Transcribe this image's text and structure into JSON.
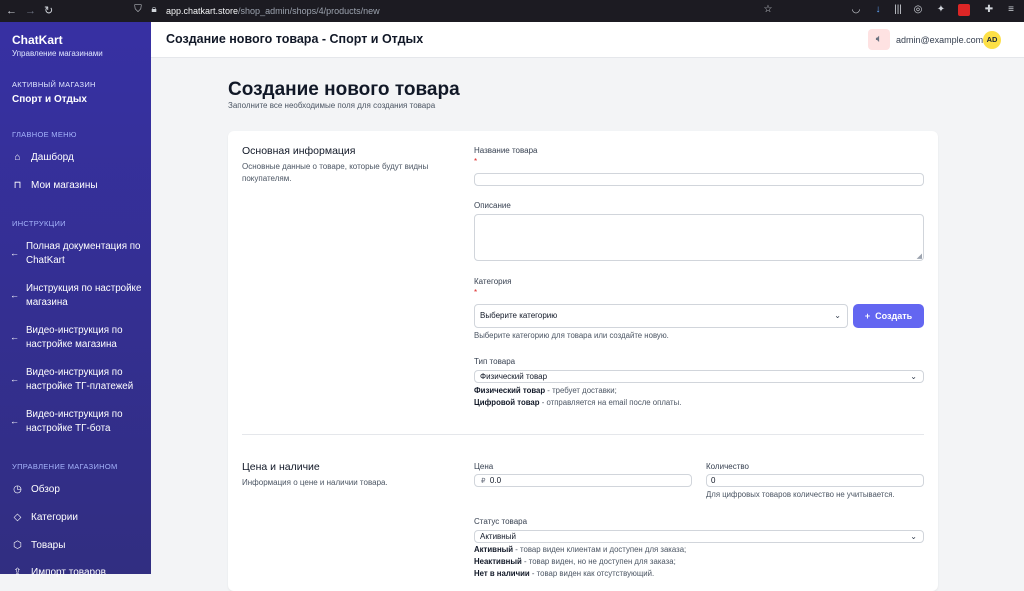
{
  "browser": {
    "url_host": "app.chatkart.store",
    "url_path": "/shop_admin/shops/4/products/new"
  },
  "sidebar": {
    "brand": "ChatKart",
    "brand_sub": "Управление магазинами",
    "active_label": "АКТИВНЫЙ МАГАЗИН",
    "active_name": "Спорт и Отдых",
    "main_menu_label": "ГЛАВНОЕ МЕНЮ",
    "main_menu": [
      "Дашборд",
      "Мои магазины"
    ],
    "instructions_label": "ИНСТРУКЦИИ",
    "instructions": [
      [
        "Полная документация по",
        "ChatKart"
      ],
      [
        "Инструкция по настройке",
        "магазина"
      ],
      [
        "Видео-инструкция по",
        "настройке магазина"
      ],
      [
        "Видео-инструкция по",
        "настройке ТГ-платежей"
      ],
      [
        "Видео-инструкция по",
        "настройке ТГ-бота"
      ]
    ],
    "manage_label": "УПРАВЛЕНИЕ МАГАЗИНОМ",
    "manage": [
      "Обзор",
      "Категории",
      "Товары",
      "Импорт товаров"
    ]
  },
  "header": {
    "title": "Создание нового товара - Спорт и Отдых",
    "email": "admin@example.com",
    "avatar": "AD"
  },
  "page": {
    "title": "Создание нового товара",
    "subtitle": "Заполните все необходимые поля для создания товара"
  },
  "basic": {
    "title": "Основная информация",
    "desc": "Основные данные о товаре, которые будут видны покупателям.",
    "name_label": "Название товара",
    "required_mark": "*",
    "name_value": "",
    "description_label": "Описание",
    "category_label": "Категория",
    "category_selected": "Выберите категорию",
    "create_button": "Создать",
    "category_help": "Выберите категорию для товара или создайте новую.",
    "type_label": "Тип товара",
    "type_selected": "Физический товар",
    "type_help": [
      {
        "bold": "Физический товар",
        "rest": " - требует доставки;"
      },
      {
        "bold": "Цифровой товар",
        "rest": " - отправляется на email после оплаты."
      }
    ]
  },
  "price": {
    "title": "Цена и наличие",
    "desc": "Информация о цене и наличии товара.",
    "price_label": "Цена",
    "currency": "₽",
    "price_value": "0.0",
    "qty_label": "Количество",
    "qty_value": "0",
    "qty_help": "Для цифровых товаров количество не учитывается.",
    "status_label": "Статус товара",
    "status_selected": "Активный",
    "status_help": [
      {
        "bold": "Активный",
        "rest": " - товар виден клиентам и доступен для заказа;"
      },
      {
        "bold": "Неактивный",
        "rest": " - товар виден, но не доступен для заказа;"
      },
      {
        "bold": "Нет в наличии",
        "rest": " - товар виден как отсутствующий."
      }
    ]
  },
  "colors": {
    "sidebar": "#3730a3",
    "accent": "#6366f1",
    "required": "#dc2626",
    "avatar": "#fde047"
  }
}
